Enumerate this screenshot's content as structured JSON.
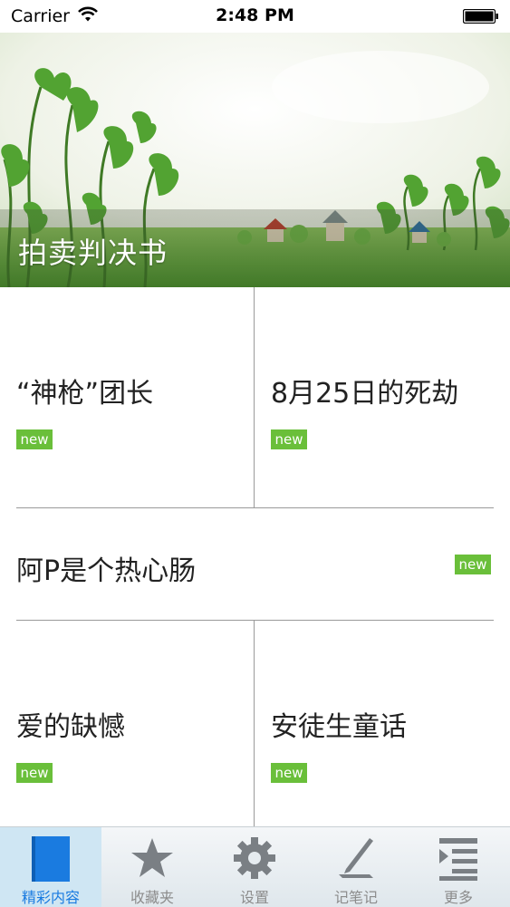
{
  "status_bar": {
    "carrier": "Carrier",
    "time": "2:48 PM"
  },
  "banner": {
    "title": "拍卖判决书"
  },
  "stories": [
    {
      "title": "“神枪”团长",
      "badge": "new"
    },
    {
      "title": "8月25日的死劫",
      "badge": "new"
    },
    {
      "title": "阿P是个热心肠",
      "badge": "new"
    },
    {
      "title": "爱的缺憾",
      "badge": "new"
    },
    {
      "title": "安徒生童话",
      "badge": "new"
    }
  ],
  "tabs": [
    {
      "label": "精彩内容",
      "icon": "book-icon",
      "active": true
    },
    {
      "label": "收藏夹",
      "icon": "star-icon",
      "active": false
    },
    {
      "label": "设置",
      "icon": "gear-icon",
      "active": false
    },
    {
      "label": "记笔记",
      "icon": "pen-icon",
      "active": false
    },
    {
      "label": "更多",
      "icon": "more-list-icon",
      "active": false
    }
  ],
  "colors": {
    "badge": "#6abf3a",
    "tab_active": "#1a7be0",
    "tab_inactive": "#8c8c8c"
  }
}
